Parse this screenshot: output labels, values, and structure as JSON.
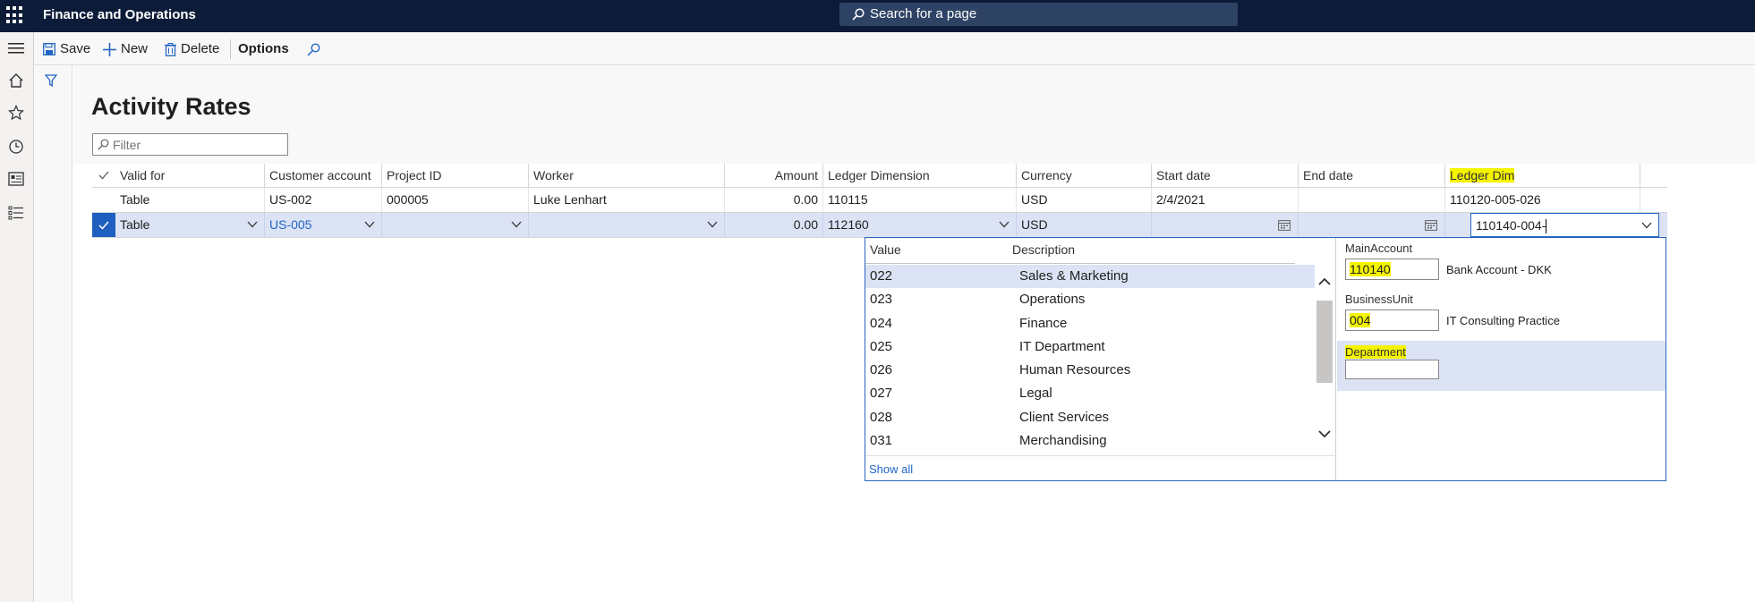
{
  "app": {
    "title": "Finance and Operations"
  },
  "search": {
    "placeholder": "Search for a page"
  },
  "toolbar": {
    "save_label": "Save",
    "new_label": "New",
    "delete_label": "Delete",
    "options_label": "Options"
  },
  "page": {
    "title": "Activity Rates"
  },
  "filter": {
    "placeholder": "Filter"
  },
  "grid": {
    "columns": [
      "Valid for",
      "Customer account",
      "Project ID",
      "Worker",
      "Amount",
      "Ledger Dimension",
      "Currency",
      "Start date",
      "End date",
      "Ledger Dim"
    ],
    "rows": [
      {
        "valid_for": "Table",
        "customer_account": "US-002",
        "project_id": "000005",
        "worker": "Luke Lenhart",
        "amount": "0.00",
        "ledger_dimension": "110115",
        "currency": "USD",
        "start_date": "2/4/2021",
        "end_date": "",
        "ledger_dim": "110120-005-026"
      },
      {
        "valid_for": "Table",
        "customer_account": "US-005",
        "project_id": "",
        "worker": "",
        "amount": "0.00",
        "ledger_dimension": "112160",
        "currency": "USD",
        "start_date": "",
        "end_date": "",
        "ledger_dim": "110140-004-"
      }
    ]
  },
  "lookup": {
    "col_value": "Value",
    "col_description": "Description",
    "items": [
      {
        "value": "022",
        "description": "Sales & Marketing"
      },
      {
        "value": "023",
        "description": "Operations"
      },
      {
        "value": "024",
        "description": "Finance"
      },
      {
        "value": "025",
        "description": "IT Department"
      },
      {
        "value": "026",
        "description": "Human Resources"
      },
      {
        "value": "027",
        "description": "Legal"
      },
      {
        "value": "028",
        "description": "Client Services"
      },
      {
        "value": "031",
        "description": "Merchandising"
      }
    ],
    "show_all": "Show all",
    "segments": {
      "main_account": {
        "label": "MainAccount",
        "value": "110140",
        "description": "Bank Account - DKK"
      },
      "business_unit": {
        "label": "BusinessUnit",
        "value": "004",
        "description": "IT Consulting Practice"
      },
      "department": {
        "label": "Department",
        "value": ""
      }
    }
  },
  "colors": {
    "topbar": "#0c1b38",
    "accent": "#2266c3",
    "selection": "#dbe3f5",
    "highlight": "#f5f500"
  }
}
